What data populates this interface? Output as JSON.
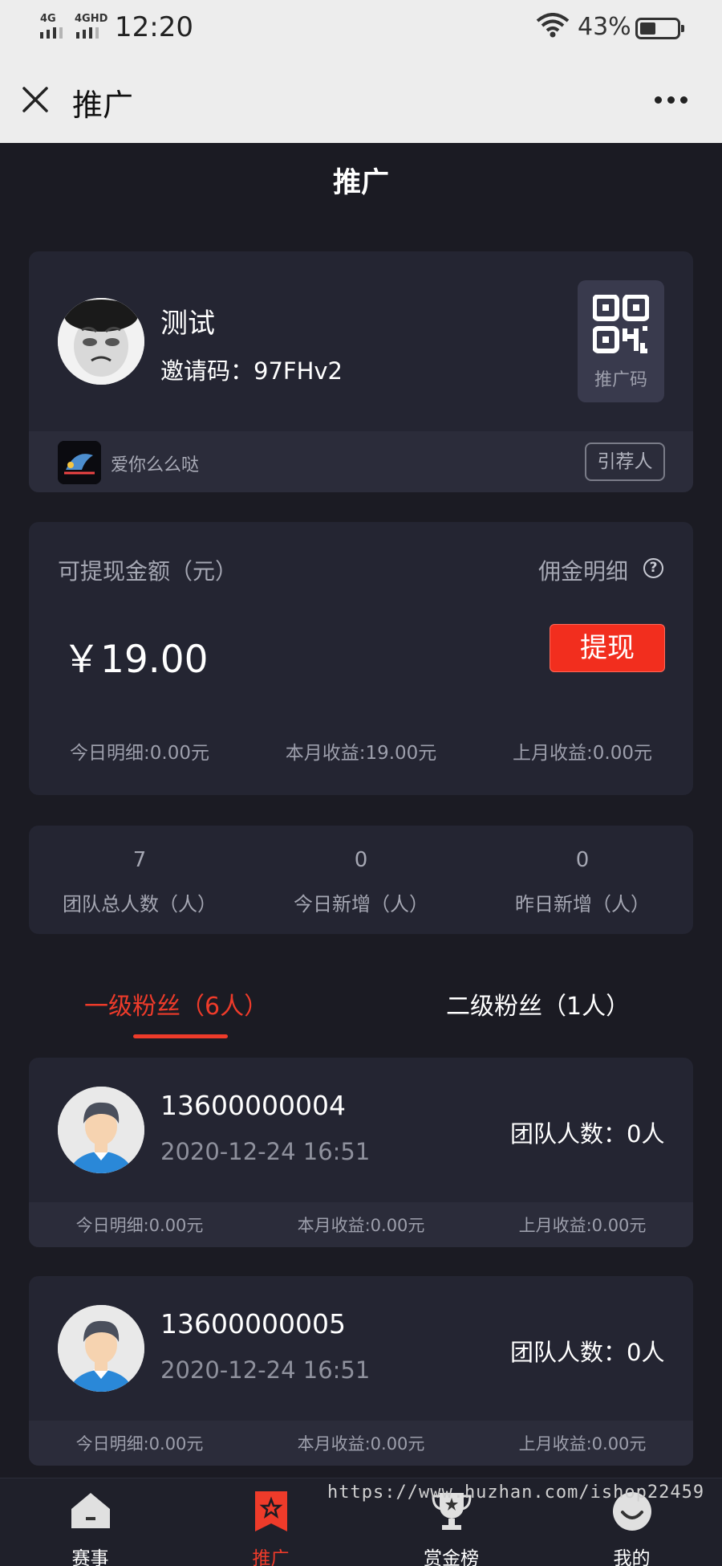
{
  "status_bar": {
    "signal1": "4G",
    "signal2": "4GHD",
    "time": "12:20",
    "battery": "43%"
  },
  "browser": {
    "title": "推广"
  },
  "page": {
    "title": "推广"
  },
  "profile": {
    "name": "测试",
    "invite_code": "邀请码：97FHv2",
    "qr_label": "推广码",
    "referrer_name": "爱你么么哒",
    "referrer_button": "引荐人"
  },
  "balance": {
    "label": "可提现金额（元）",
    "detail_link": "佣金明细",
    "amount": "￥19.00",
    "withdraw_button": "提现",
    "today": "今日明细:0.00元",
    "this_month": "本月收益:19.00元",
    "last_month": "上月收益:0.00元"
  },
  "team": {
    "stats": [
      {
        "value": "7",
        "label": "团队总人数（人）"
      },
      {
        "value": "0",
        "label": "今日新增（人）"
      },
      {
        "value": "0",
        "label": "昨日新增（人）"
      }
    ]
  },
  "tabs": {
    "first": "一级粉丝（6人）",
    "second": "二级粉丝（1人）"
  },
  "fans": [
    {
      "phone": "13600000004",
      "date": "2020-12-24 16:51",
      "team_count": "团队人数：0人",
      "today": "今日明细:0.00元",
      "this_month": "本月收益:0.00元",
      "last_month": "上月收益:0.00元"
    },
    {
      "phone": "13600000005",
      "date": "2020-12-24 16:51",
      "team_count": "团队人数：0人",
      "today": "今日明细:0.00元",
      "this_month": "本月收益:0.00元",
      "last_month": "上月收益:0.00元"
    }
  ],
  "nav": [
    {
      "label": "赛事",
      "icon": "home-icon"
    },
    {
      "label": "推广",
      "icon": "badge-icon"
    },
    {
      "label": "赏金榜",
      "icon": "trophy-icon"
    },
    {
      "label": "我的",
      "icon": "smile-icon"
    }
  ],
  "watermark": "https://www.huzhan.com/ishop22459",
  "colors": {
    "accent": "#ee3b2a",
    "background": "#1b1b23",
    "card": "#242532"
  }
}
